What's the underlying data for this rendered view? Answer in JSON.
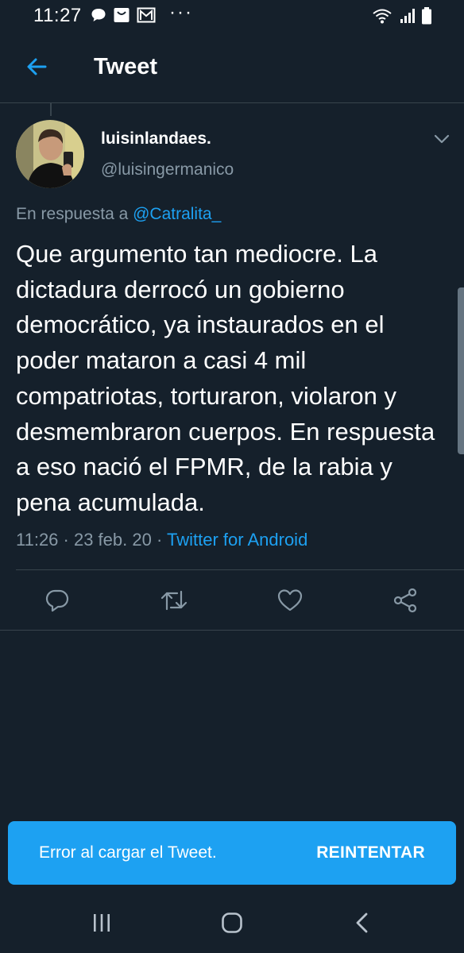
{
  "status_bar": {
    "time": "11:27",
    "dots": "···",
    "icons": [
      "message-icon",
      "bag-icon",
      "mail-icon",
      "wifi-icon",
      "signal-icon",
      "battery-icon"
    ]
  },
  "app_bar": {
    "title": "Tweet",
    "back_icon": "back-arrow-icon"
  },
  "tweet": {
    "display_name": "luisinlandaes.",
    "handle": "@luisingermanico",
    "reply_prefix": "En respuesta a ",
    "reply_to": "@Catralita_",
    "text": "Que argumento tan mediocre. La dictadura derrocó un gobierno democrático, ya instaurados en el poder mataron a casi 4 mil compatriotas, torturaron, violaron y desmembraron cuerpos. En respuesta a eso nació el FPMR, de la rabia y pena acumulada.",
    "timestamp": "11:26 · 23 feb. 20 · ",
    "source": "Twitter for Android",
    "actions": [
      "reply-icon",
      "retweet-icon",
      "like-icon",
      "share-icon"
    ]
  },
  "snackbar": {
    "message": "Error al cargar el Tweet.",
    "action": "REINTENTAR"
  },
  "nav_bar": {
    "buttons": [
      "recent-apps-icon",
      "home-icon",
      "back-icon"
    ]
  },
  "colors": {
    "background": "#15202b",
    "accent": "#1da1f2",
    "secondary_text": "#8899a6",
    "divider": "#38444d"
  }
}
